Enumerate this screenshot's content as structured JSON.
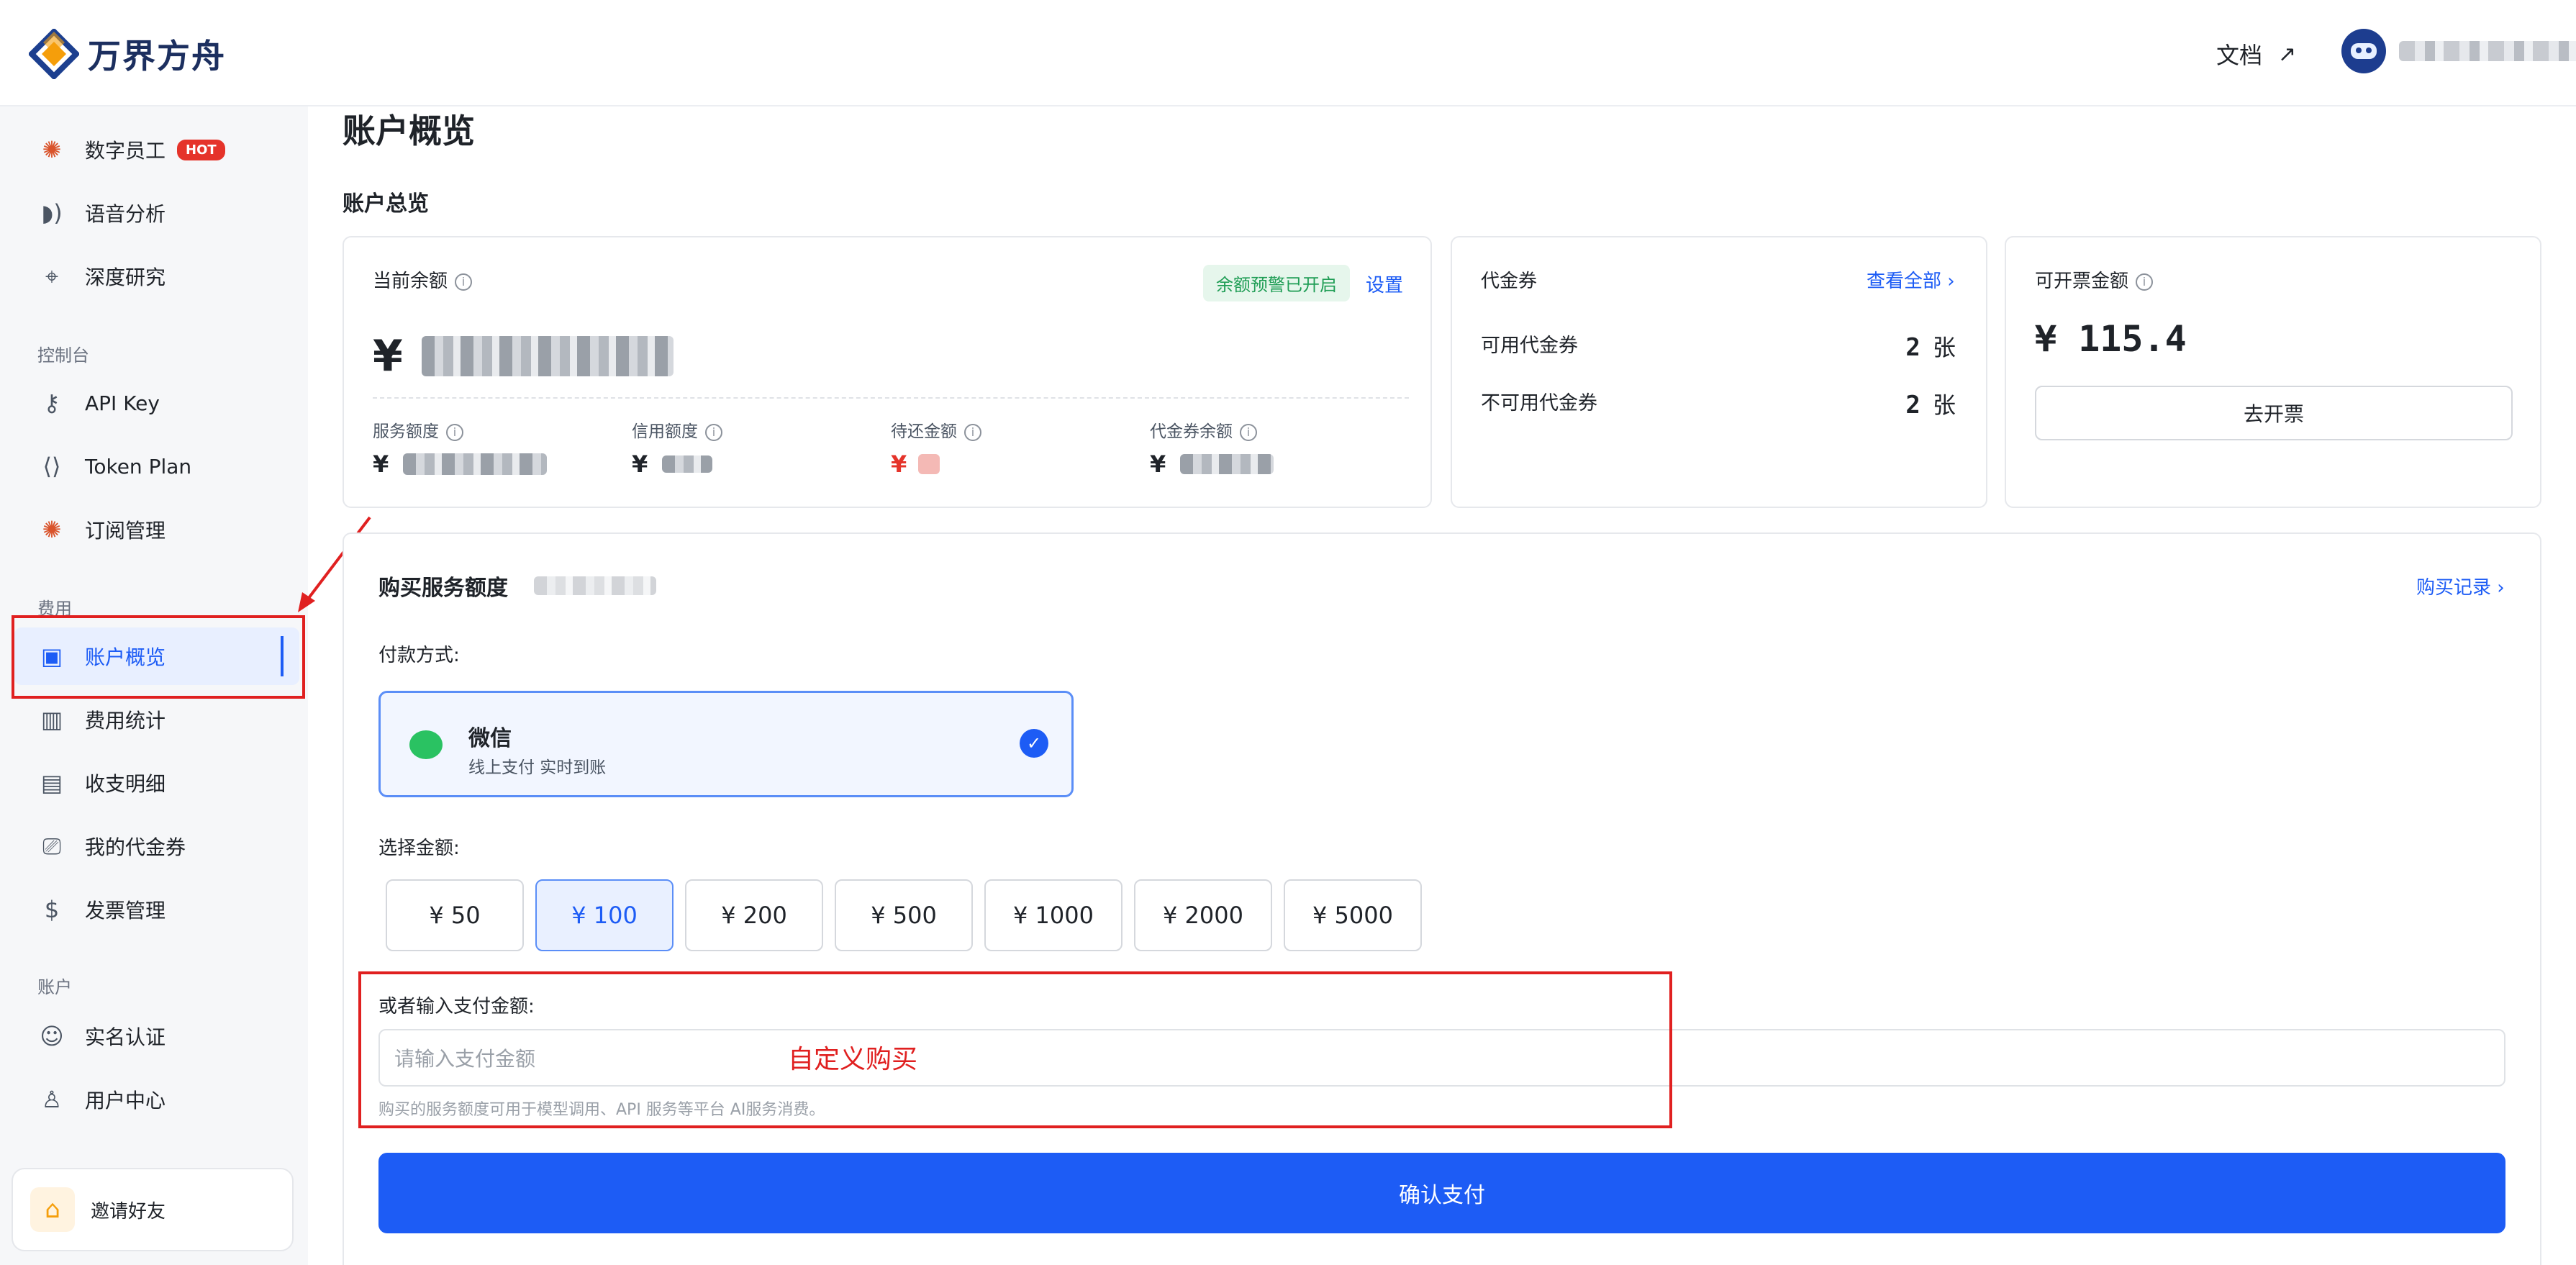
{
  "header": {
    "brand": "万界方舟",
    "docs_label": "文档",
    "docs_arrow": "↗"
  },
  "sidebar": {
    "items": [
      {
        "label": "数字员工",
        "badge": "HOT",
        "icon": "lobster-icon"
      },
      {
        "label": "语音分析",
        "icon": "voice-icon"
      },
      {
        "label": "深度研究",
        "icon": "telescope-icon"
      },
      {
        "label": "API Key",
        "icon": "key-icon"
      },
      {
        "label": "Token Plan",
        "icon": "code-icon"
      },
      {
        "label": "订阅管理",
        "icon": "lobster-icon"
      },
      {
        "label": "账户概览",
        "icon": "wallet-icon"
      },
      {
        "label": "费用统计",
        "icon": "bar-chart-icon"
      },
      {
        "label": "收支明细",
        "icon": "document-icon"
      },
      {
        "label": "我的代金券",
        "icon": "ticket-icon"
      },
      {
        "label": "发票管理",
        "icon": "invoice-icon"
      },
      {
        "label": "实名认证",
        "icon": "user-check-icon"
      },
      {
        "label": "用户中心",
        "icon": "user-icon"
      }
    ],
    "sections": {
      "console": "控制台",
      "billing": "费用",
      "account": "账户"
    },
    "invite_label": "邀请好友"
  },
  "main": {
    "page_title": "账户概览",
    "overview_title": "账户总览",
    "balance": {
      "label": "当前余额",
      "currency": "¥",
      "warning_badge": "余额预警已开启",
      "settings_link": "设置",
      "sub": [
        {
          "label": "服务额度",
          "currency": "¥"
        },
        {
          "label": "信用额度",
          "currency": "¥"
        },
        {
          "label": "待还金额",
          "currency": "¥"
        },
        {
          "label": "代金券余额",
          "currency": "¥"
        }
      ]
    },
    "vouchers": {
      "title": "代金券",
      "view_all": "查看全部 ›",
      "available_label": "可用代金券",
      "available_count": "2",
      "unavailable_label": "不可用代金券",
      "unavailable_count": "2",
      "unit": "张"
    },
    "invoice": {
      "label": "可开票金额",
      "amount": "¥ 115.4",
      "button": "去开票"
    },
    "purchase": {
      "title": "购买服务额度",
      "history_link": "购买记录 ›",
      "payment_label": "付款方式:",
      "wechat_name": "微信",
      "wechat_sub": "线上支付 实时到账",
      "amount_label": "选择金额:",
      "amounts": [
        "¥ 50",
        "¥ 100",
        "¥ 200",
        "¥ 500",
        "¥ 1000",
        "¥ 2000",
        "¥ 5000"
      ],
      "selected_amount": "¥ 100",
      "custom_label": "或者输入支付金额:",
      "custom_placeholder": "请输入支付金额",
      "hint": "购买的服务额度可用于模型调用、API 服务等平台 AI服务消费。",
      "confirm_button": "确认支付"
    },
    "annotation_text": "自定义购买"
  },
  "colors": {
    "accent": "#1d5cf5",
    "annotation_red": "#e02020",
    "success_green": "#1f9d55"
  }
}
